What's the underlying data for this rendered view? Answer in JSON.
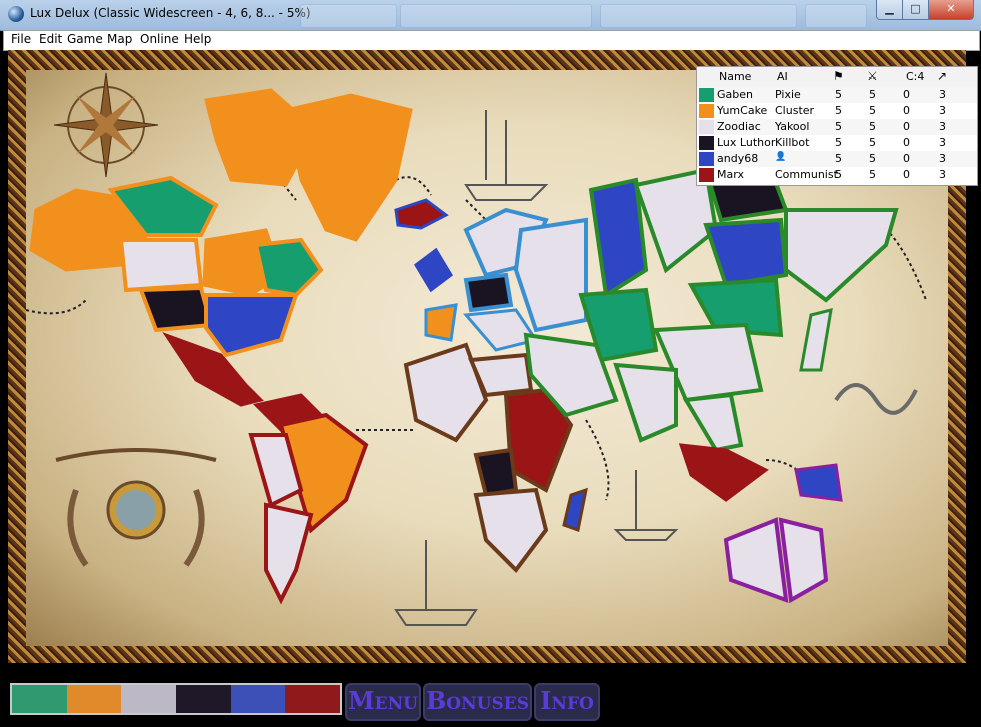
{
  "window": {
    "title": "Lux Delux (Classic Widescreen - 4, 6, 8... - 5%)",
    "minimize_label": "▁",
    "maximize_label": "□",
    "close_label": "✕"
  },
  "menu": [
    "File",
    "Edit",
    "Game",
    "Map",
    "Online",
    "Help"
  ],
  "stats": {
    "headers": {
      "name": "Name",
      "ai": "AI",
      "flag_icon": "flag-icon",
      "army_icon": "army-icon",
      "cards": "C:4",
      "chart_icon": "chart-icon"
    },
    "players": [
      {
        "color": "#169e6f",
        "name": "Gaben",
        "ai": "Pixie",
        "a": "5",
        "b": "5",
        "c": "0",
        "d": "3"
      },
      {
        "color": "#f2901e",
        "name": "YumCake",
        "ai": "Cluster",
        "a": "5",
        "b": "5",
        "c": "0",
        "d": "3"
      },
      {
        "color": "#e5e0ea",
        "name": "Zoodiac",
        "ai": "Yakool",
        "a": "5",
        "b": "5",
        "c": "0",
        "d": "3"
      },
      {
        "color": "#1a1422",
        "name": "Lux Luthor",
        "ai": "Killbot",
        "a": "5",
        "b": "5",
        "c": "0",
        "d": "3"
      },
      {
        "color": "#2e46c4",
        "name": "andy68",
        "ai": "",
        "ai_icon": "human-icon",
        "a": "5",
        "b": "5",
        "c": "0",
        "d": "3"
      },
      {
        "color": "#9b1416",
        "name": "Marx",
        "ai": "Communist",
        "a": "5",
        "b": "5",
        "c": "0",
        "d": "3"
      }
    ]
  },
  "bottom": {
    "menu_button": "Menu",
    "bonuses_button": "Bonuses",
    "info_button": "Info",
    "bar_colors": [
      "#2f9a70",
      "#e08a2c",
      "#bdb8c6",
      "#1e1828",
      "#3c50b8",
      "#8f1a1c"
    ]
  },
  "map": {
    "name": "Classic Widescreen"
  }
}
